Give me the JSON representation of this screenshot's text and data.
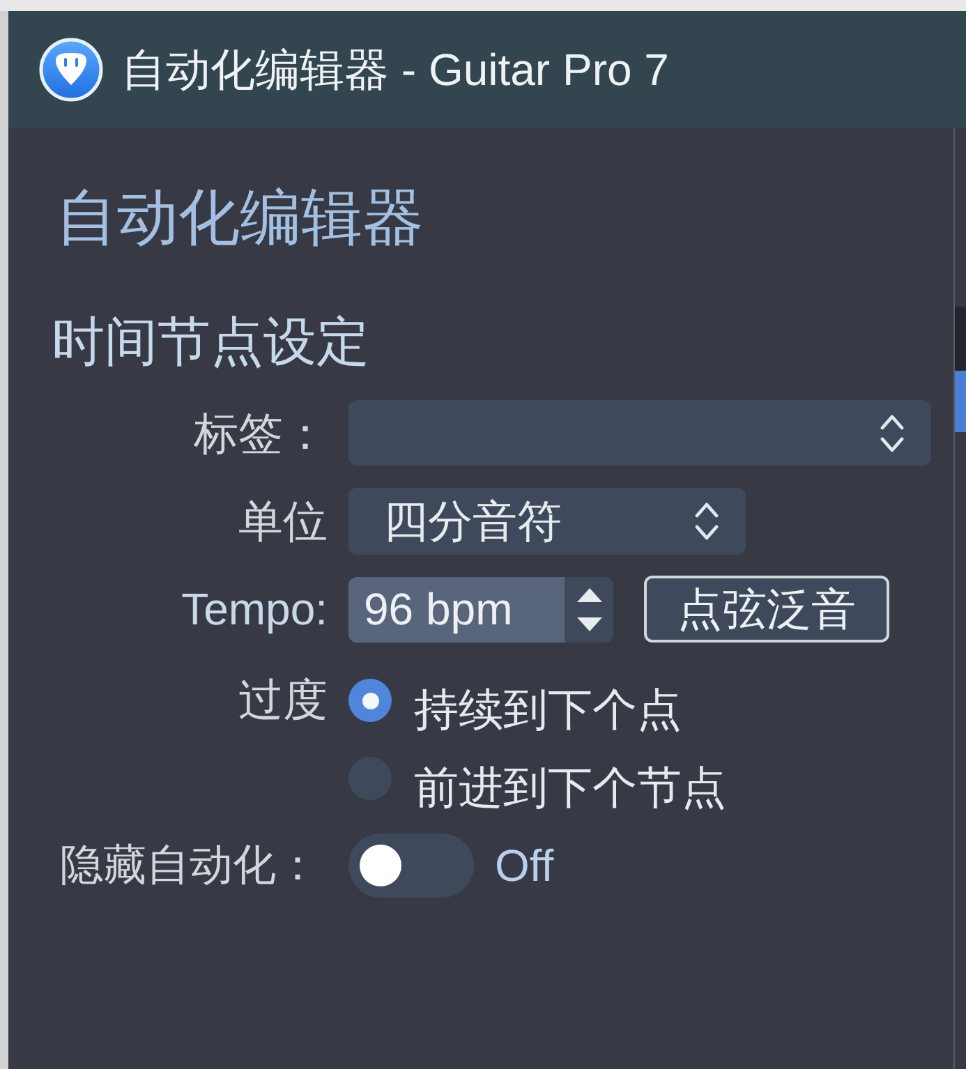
{
  "window": {
    "title": "自动化编辑器 - Guitar Pro 7"
  },
  "heading": "自动化编辑器",
  "section": {
    "title": "时间节点设定",
    "tag": {
      "label": "标签："
    },
    "unit": {
      "label": "单位",
      "value": "四分音符"
    },
    "tempo": {
      "label": "Tempo:",
      "value": "96 bpm"
    },
    "button": "点弦泛音",
    "transition": {
      "label": "过度",
      "options": [
        {
          "label": "持续到下个点",
          "selected": true
        },
        {
          "label": "前进到下个节点",
          "selected": false
        }
      ]
    },
    "hide_automation": {
      "label": "隐藏自动化：",
      "on": false,
      "state_text": "Off"
    }
  }
}
